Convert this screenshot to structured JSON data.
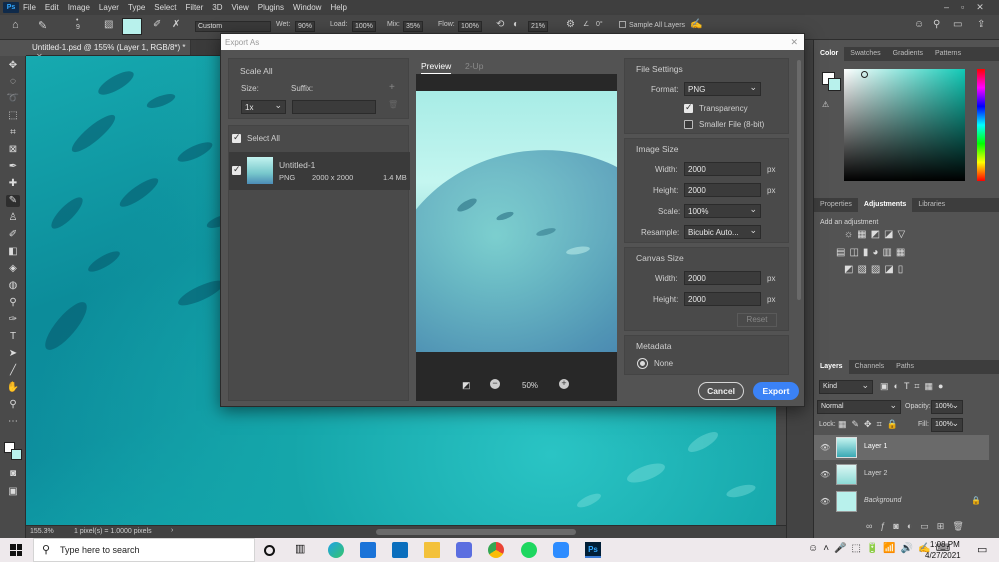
{
  "menu": [
    "File",
    "Edit",
    "Image",
    "Layer",
    "Type",
    "Select",
    "Filter",
    "3D",
    "View",
    "Plugins",
    "Window",
    "Help"
  ],
  "options": {
    "brush_size": "9",
    "preset": "Custom",
    "wet_label": "Wet:",
    "wet": "90%",
    "load_label": "Load:",
    "load": "100%",
    "mix_label": "Mix:",
    "mix": "35%",
    "flow_label": "Flow:",
    "flow": "100%",
    "smoothing": "21%",
    "angle": "0°",
    "sample_all": "Sample All Layers"
  },
  "document": {
    "tab": "Untitled-1.psd @ 155% (Layer 1, RGB/8*) *"
  },
  "status": {
    "zoom": "155.3%",
    "info": "1 pixel(s) = 1.0000 pixels"
  },
  "dialog": {
    "title": "Export As",
    "scale_all": "Scale All",
    "size_label": "Size:",
    "suffix_label": "Suffix:",
    "size_value": "1x",
    "select_all": "Select All",
    "item_name": "Untitled-1",
    "item_format": "PNG",
    "item_dims": "2000 x 2000",
    "item_size": "1.4 MB",
    "tab_preview": "Preview",
    "tab_2up": "2-Up",
    "zoom": "50%",
    "file_settings": "File Settings",
    "format_label": "Format:",
    "format_value": "PNG",
    "transparency": "Transparency",
    "smaller_file": "Smaller File (8-bit)",
    "image_size": "Image Size",
    "width_label": "Width:",
    "width_value": "2000",
    "height_label": "Height:",
    "height_value": "2000",
    "unit": "px",
    "scale_label": "Scale:",
    "scale_value": "100%",
    "resample_label": "Resample:",
    "resample_value": "Bicubic Auto...",
    "canvas_size": "Canvas Size",
    "canvas_width": "2000",
    "canvas_height": "2000",
    "reset": "Reset",
    "metadata": "Metadata",
    "metadata_none": "None",
    "cancel": "Cancel",
    "export": "Export",
    "colors": {
      "export_button": "#3b82f6"
    }
  },
  "panels": {
    "color_tabs": [
      "Color",
      "Swatches",
      "Gradients",
      "Patterns"
    ],
    "adjust_tabs": [
      "Properties",
      "Adjustments",
      "Libraries"
    ],
    "add_adjustment": "Add an adjustment",
    "layer_tabs": [
      "Layers",
      "Channels",
      "Paths"
    ],
    "kind": "Kind",
    "blend_mode": "Normal",
    "opacity_label": "Opacity:",
    "opacity": "100%",
    "lock_label": "Lock:",
    "fill_label": "Fill:",
    "fill": "100%",
    "layers": [
      "Layer 1",
      "Layer 2",
      "Background"
    ]
  },
  "taskbar": {
    "search_placeholder": "Type here to search",
    "time": "1:08 PM",
    "date": "4/27/2021"
  }
}
